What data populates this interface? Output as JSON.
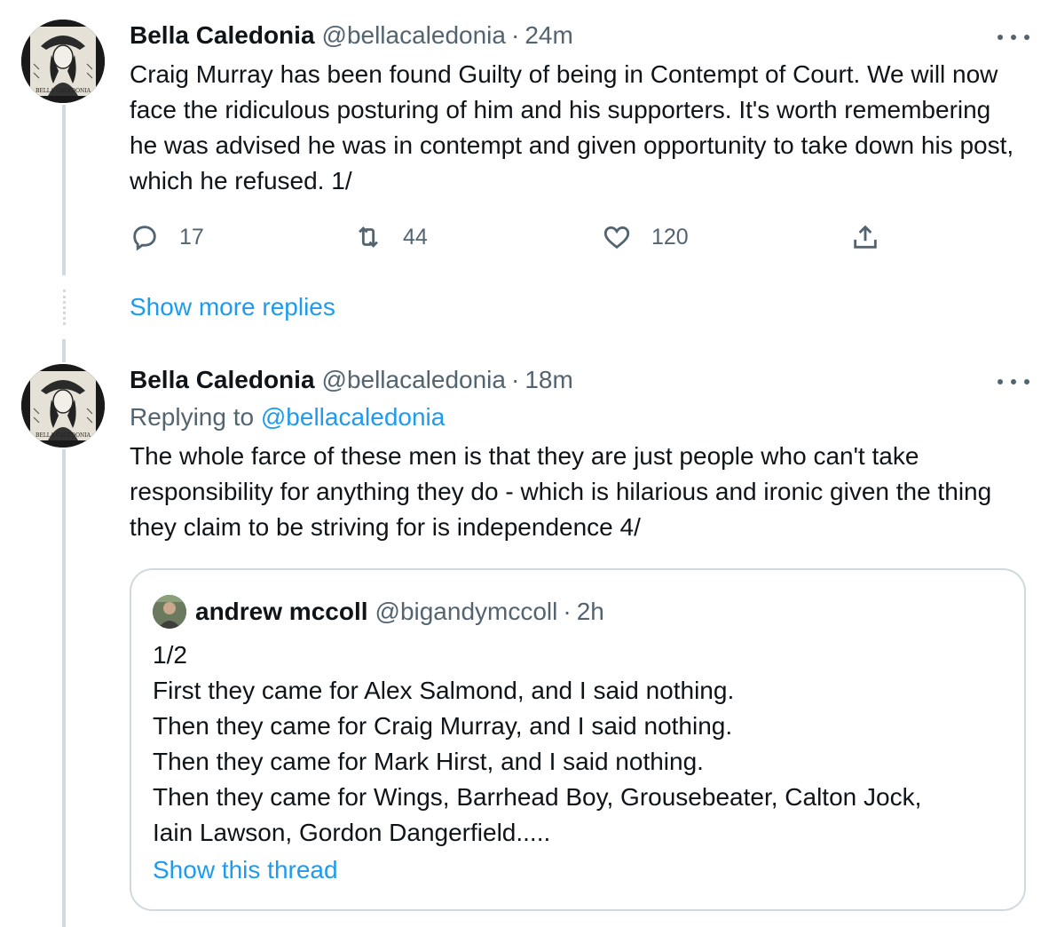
{
  "tweet1": {
    "name": "Bella Caledonia",
    "handle": "@bellacaledonia",
    "separator": "·",
    "time": "24m",
    "text": "Craig Murray has been found Guilty of being in Contempt of Court. We will now face the ridiculous posturing of him and his supporters. It's worth remembering he was advised he was in contempt and given opportunity to take down his post, which he refused. 1/",
    "avatar_label": "BELLA CALEDONIA",
    "actions": {
      "reply_count": "17",
      "retweet_count": "44",
      "like_count": "120"
    }
  },
  "show_more_replies": "Show more replies",
  "tweet2": {
    "name": "Bella Caledonia",
    "handle": "@bellacaledonia",
    "separator": "·",
    "time": "18m",
    "replying_prefix": "Replying to",
    "replying_to": "@bellacaledonia",
    "text": "The whole farce of these men is that they are just people who can't take responsibility for anything they do - which is hilarious and ironic given the thing they claim to be striving for is independence 4/",
    "avatar_label": "BELLA CALEDONIA"
  },
  "quote": {
    "name": "andrew mccoll",
    "handle": "@bigandymccoll",
    "separator": "·",
    "time": "2h",
    "lines": [
      "1/2",
      "First they came for Alex Salmond, and I said nothing.",
      "Then they came for Craig Murray, and I said nothing.",
      "Then they came for Mark Hirst, and I said nothing.",
      "Then they came for Wings, Barrhead Boy, Grousebeater, Calton Jock,",
      "Iain Lawson, Gordon Dangerfield....."
    ],
    "show_thread": "Show this thread"
  },
  "icons": {
    "reply": "reply-icon",
    "retweet": "retweet-icon",
    "like": "heart-icon",
    "share": "share-icon",
    "more": "more-icon"
  },
  "colors": {
    "link": "#1d9bf0",
    "secondary": "#536471",
    "thread_line": "#cfd9de"
  }
}
